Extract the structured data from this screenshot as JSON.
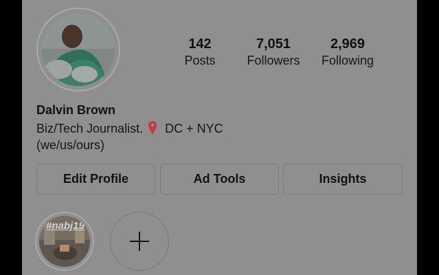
{
  "profile": {
    "name": "Dalvin Brown",
    "bio_line1": "Biz/Tech Journalist.",
    "bio_line1_after": "DC + NYC",
    "bio_line2": "(we/us/ours)"
  },
  "stats": {
    "posts": {
      "value": "142",
      "label": "Posts"
    },
    "followers": {
      "value": "7,051",
      "label": "Followers"
    },
    "following": {
      "value": "2,969",
      "label": "Following"
    }
  },
  "buttons": {
    "edit_profile": "Edit Profile",
    "ad_tools": "Ad Tools",
    "insights": "Insights"
  },
  "stories": {
    "highlight_tag": "#nabj19"
  },
  "icons": {
    "location": "location-pin-icon",
    "add": "plus-icon"
  },
  "colors": {
    "overlay_bg": "#8f8f8f",
    "pin_red": "#c73b3b"
  }
}
